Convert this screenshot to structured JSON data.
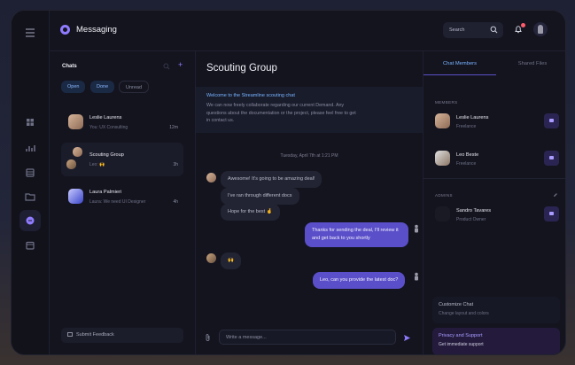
{
  "app": {
    "title": "Messaging"
  },
  "header": {
    "search_placeholder": "Search",
    "notifications": "notifications"
  },
  "chats": {
    "title": "Chats",
    "filters": [
      {
        "label": "Open",
        "active": true
      },
      {
        "label": "Done",
        "active": true
      },
      {
        "label": "Unread",
        "active": false
      }
    ],
    "items": [
      {
        "name": "Leslie Laurens",
        "preview": "You: UX Consulting",
        "time": "12m"
      },
      {
        "name": "Scouting Group",
        "preview": "Leo: 🙌",
        "time": "3h"
      },
      {
        "name": "Laura Palmieri",
        "preview": "Laura: We need UI Designer",
        "time": "4h"
      }
    ],
    "feedback_label": "Submit Feedback"
  },
  "conversation": {
    "title": "Scouting Group",
    "welcome_title": "Welcome to the Streamline scouting chat",
    "welcome_body": "We can now freely collaborate regarding our current Demand. Any questions about the documentation or the project, please feel free to get in contact us.",
    "date": "Tuesday, April 7th at 1:21 PM",
    "messages": [
      {
        "text": "Awesome! It's going to be amazing deal!",
        "dir": "in"
      },
      {
        "text": "I've ran through different docs",
        "dir": "in"
      },
      {
        "text": "Hope for the best 🤞",
        "dir": "in"
      },
      {
        "text": "Thanks for sending the deal, I'll review it and get back to you shortly",
        "dir": "out"
      },
      {
        "text": "🙌",
        "dir": "in"
      },
      {
        "text": "Leo, can you provide the latest doc?",
        "dir": "out"
      }
    ],
    "composer_placeholder": "Write a message..."
  },
  "right_panel": {
    "tabs": [
      "Chat Members",
      "Shared Files"
    ],
    "members_label": "MEMBERS",
    "members": [
      {
        "name": "Leslie Laurens",
        "role": "Freelance"
      },
      {
        "name": "Leo Beste",
        "role": "Freelance"
      }
    ],
    "admins_label": "ADMINS",
    "admins": [
      {
        "name": "Sandro Tavares",
        "role": "Product Owner"
      }
    ],
    "cards": [
      {
        "title": "Customize Chat",
        "subtitle": "Change layout and colors"
      },
      {
        "title": "Privacy and Support",
        "subtitle": "Get immediate support"
      }
    ]
  },
  "colors": {
    "accent": "#5a4fc8",
    "link": "#78b4ff",
    "badge": "#ff5b6b"
  }
}
